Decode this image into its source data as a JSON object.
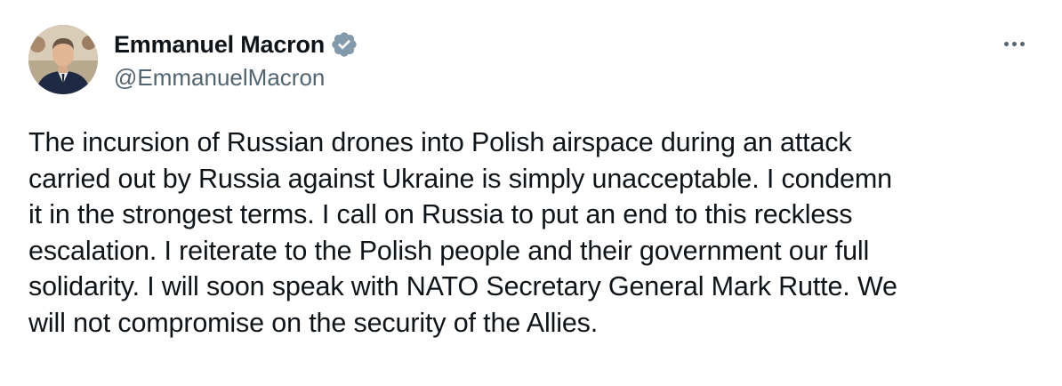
{
  "author": {
    "display_name": "Emmanuel Macron",
    "handle": "@EmmanuelMacron",
    "verified": true,
    "verified_color": "#829aab"
  },
  "tweet": {
    "text": "The incursion of Russian drones into Polish airspace during an attack\ncarried out by Russia against Ukraine is simply unacceptable. I condemn\nit in the strongest terms. I call on Russia to put an end to this reckless\nescalation. I reiterate to the Polish people and their government our full\nsolidarity. I will soon speak with NATO Secretary General Mark Rutte. We\nwill not compromise on the security of the Allies."
  },
  "icons": {
    "more": "more-horizontal-icon",
    "verified": "verified-badge-icon"
  }
}
